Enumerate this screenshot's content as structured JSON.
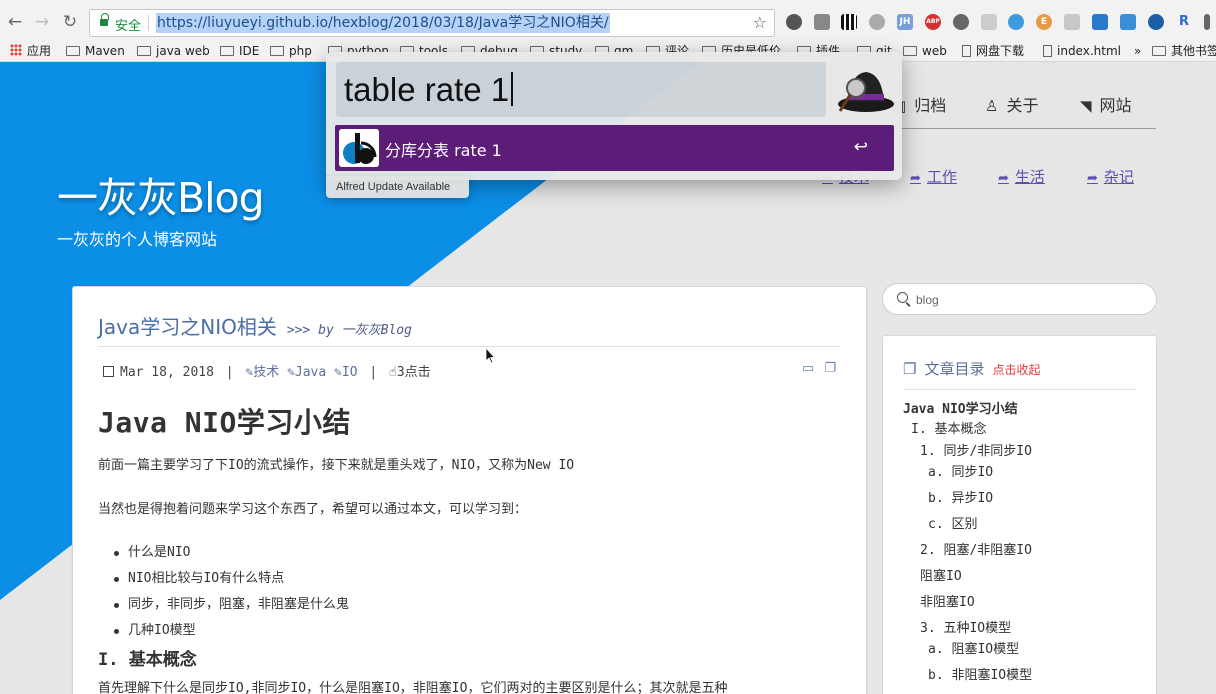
{
  "browser": {
    "secure_label": "安全",
    "url": "https://liuyueyi.github.io/hexblog/2018/03/18/Java学习之NIO相关/",
    "extensions": [
      "JH",
      "ABP",
      "E",
      "R"
    ],
    "bookmarks": [
      "应用",
      "Maven",
      "java web",
      "IDE",
      "php",
      "python",
      "tools",
      "debug",
      "study",
      "gm",
      "评论",
      "历史是低价",
      "插件",
      "git",
      "web",
      "网盘下载",
      "index.html",
      "»",
      "其他书签"
    ]
  },
  "alfred": {
    "query": "table rate 1",
    "result_title": "分库分表 rate 1",
    "enter_symbol": "↩",
    "update_notice": "Alfred Update Available"
  },
  "blog": {
    "title": "一灰灰Blog",
    "subtitle": "一灰灰的个人博客网站",
    "nav": [
      "归档",
      "关于",
      "网站"
    ],
    "categories": [
      "技术",
      "工作",
      "生活",
      "杂记"
    ]
  },
  "post": {
    "title": "Java学习之NIO相关",
    "by": ">>> by 一灰灰Blog",
    "date": "Mar 18, 2018",
    "tags": [
      "技术",
      "Java",
      "IO"
    ],
    "clicks": "3点击",
    "h1": "Java NIO学习小结",
    "p1": "前面一篇主要学习了下IO的流式操作，接下来就是重头戏了，NIO，又称为New IO",
    "p2": "当然也是得抱着问题来学习这个东西了，希望可以通过本文，可以学习到：",
    "list": [
      "什么是NIO",
      "NIO相比较与IO有什么特点",
      "同步，非同步，阻塞，非阻塞是什么鬼",
      "几种IO模型"
    ],
    "h2": "I. 基本概念",
    "p3": "首先理解下什么是同步IO,非同步IO，什么是阻塞IO，非阻塞IO，它们两对的主要区别是什么；其次就是五种"
  },
  "search": {
    "placeholder": "blog"
  },
  "toc": {
    "title": "文章目录",
    "collapse": "点击收起",
    "items": [
      "Java NIO学习小结",
      "I. 基本概念",
      "1. 同步/非同步IO",
      "a. 同步IO",
      "b. 异步IO",
      "c. 区别",
      "2. 阻塞/非阻塞IO",
      "阻塞IO",
      "非阻塞IO",
      "3. 五种IO模型",
      "a. 阻塞IO模型",
      "b. 非阻塞IO模型"
    ]
  }
}
